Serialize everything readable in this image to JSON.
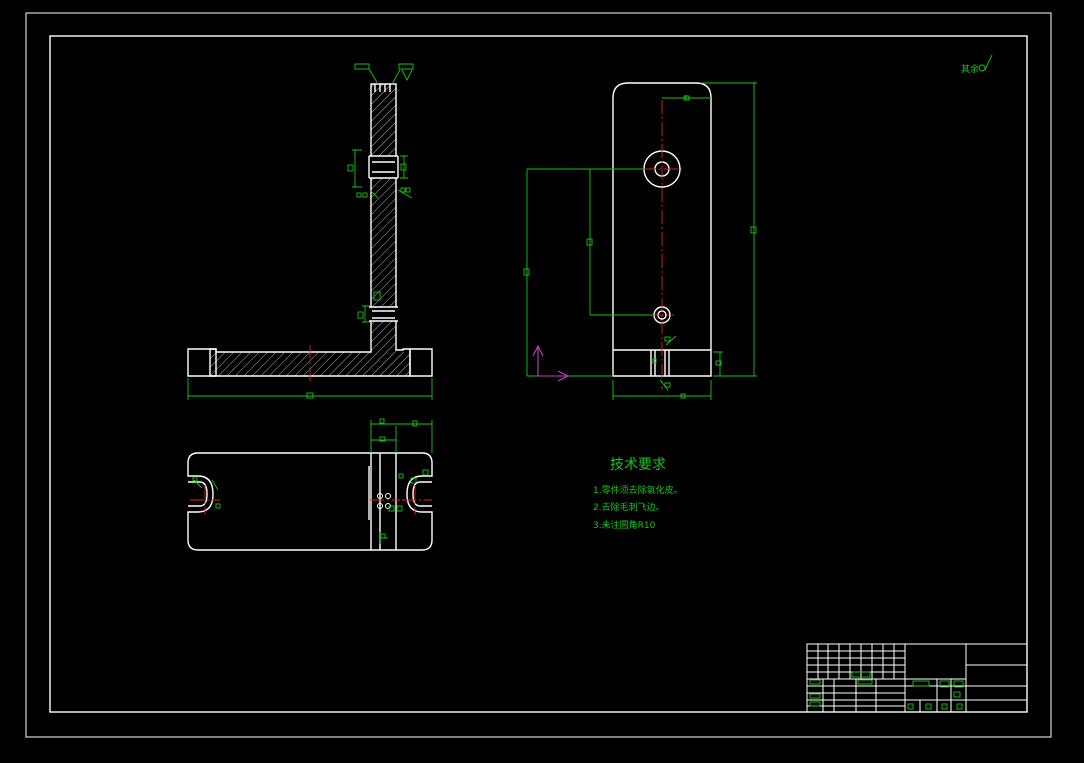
{
  "technical_requirements": {
    "title": "技术要求",
    "items": [
      "1.零件须去除氧化皮。",
      "2.去除毛刺飞边。",
      "3.未注圆角R10"
    ]
  },
  "surface_finish_note": "其余",
  "colors": {
    "background": "#000000",
    "outline": "#ffffff",
    "dimension": "#19c519",
    "centerline": "#e02020",
    "ucs_icon": "#c040c0"
  }
}
